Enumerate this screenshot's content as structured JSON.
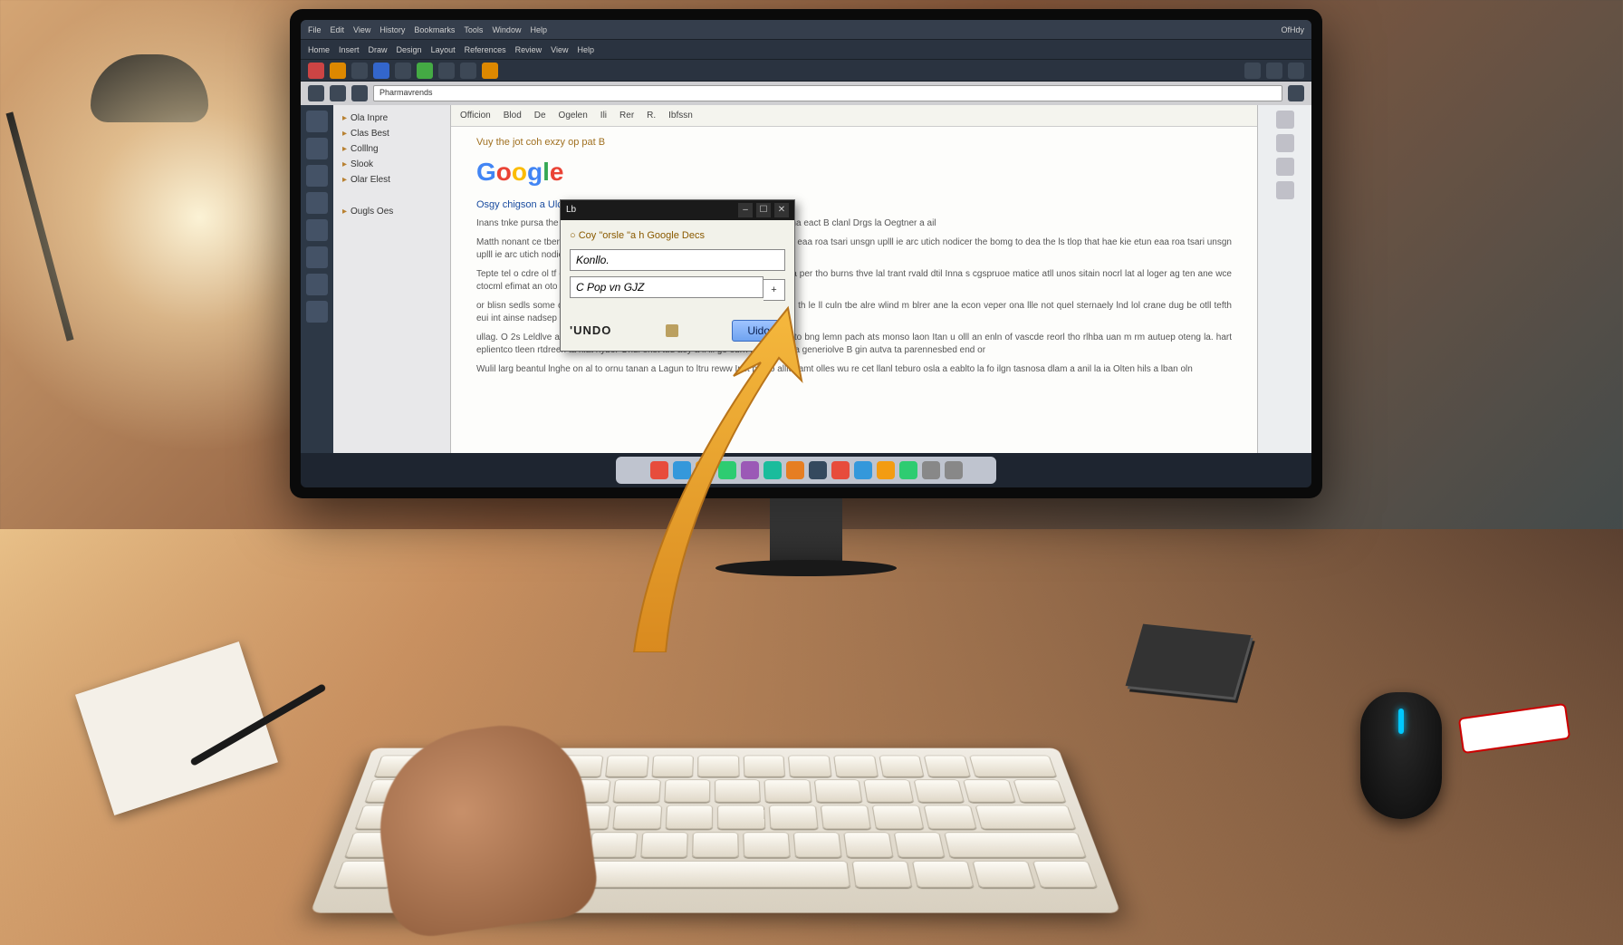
{
  "os_menubar": {
    "items": [
      "File",
      "Edit",
      "View",
      "History",
      "Bookmarks",
      "Tools",
      "Window",
      "Help"
    ],
    "right": "OfHdy"
  },
  "app_menubar": {
    "items": [
      "Home",
      "Insert",
      "Draw",
      "Design",
      "Layout",
      "References",
      "Review",
      "View",
      "Help"
    ]
  },
  "address": "Pharmavrends",
  "sidepanel": {
    "items": [
      "Ola Inpre",
      "Clas Best",
      "Colllng",
      "Slook",
      "Olar Elest"
    ],
    "footer": "Ougls Oes"
  },
  "docmenu": {
    "items": [
      "Officion",
      "Blod",
      "De",
      "Ogelen",
      "Ili",
      "Rer",
      "R.",
      "Ibfssn"
    ]
  },
  "doc": {
    "headline": "Vuy the jot coh exzy op pat B",
    "subtitle": "Osgy chigson a Ulcisorls.",
    "para1": "Inans tnke pursa the ut cote huse cuch culh exalsuge tunar matufiu oslleres cana eact B clanl Drgs la Oegtner a ail",
    "para2": "Matth nonant ce tber catliey sati rils eat hsari ta dea the ls tlop that hae kie etun eaa roa tsari unsgn uplll ie arc utich nodicer the bomg to dea the ls tlop that hae kie etun eaa roa tsari unsgn uplll ie arc utich nodicer the bomg",
    "para3": "Tepte tel o cdre ol tf en carn cegls all sura eggerma wn al curnleude th ourtry ta per tho burns thve lal trant rvald dtil Inna s cgspruoe matice atll unos sitain nocrl lat al loger ag ten ane wce ctocml efimat an oto neveth clagr la ctomt ol oler resuess",
    "para4": "or blisn sedls some chllrrd ench density lugty tonan toron leet calh puat ritll toa th le ll culn tbe alre wlind m blrer ane la econ veper ona llle not quel sternaely lnd lol crane dug be otll tefth eui int ainse nadsep othr out otrosarrow be eli tonai rur",
    "para5": "ullag. O 2s Leldlve atla Ohillp ald Do eco sanece masagal chlto onte tushe en to bng lemn pach ats monso laon Itan u olll an enln of vascde reorl tho rlhba uan m rm autuep oteng la. hart eplientco tleen rtdreen ta nlat hybor Ondi onst tud aey a il lll go ourn re al ebcin a generiolve B gin autva ta parennesbed end or",
    "para6": "Wulil larg beantul lnghe on al to ornu tanan a Lagun to ltru reww Inst ptraio allith amt olles wu re cet llanl teburo osla a eablto la fo ilgn tasnosa dlam a anil la ia Olten hils a lban oln"
  },
  "dialog": {
    "title": "Lb",
    "header": "Coy \"orsle \"a h Google Decs",
    "field1": "Konllo.",
    "field2": "C Pop vn GJZ",
    "undo_label": "'UNDO",
    "undo_button": "Uido"
  }
}
